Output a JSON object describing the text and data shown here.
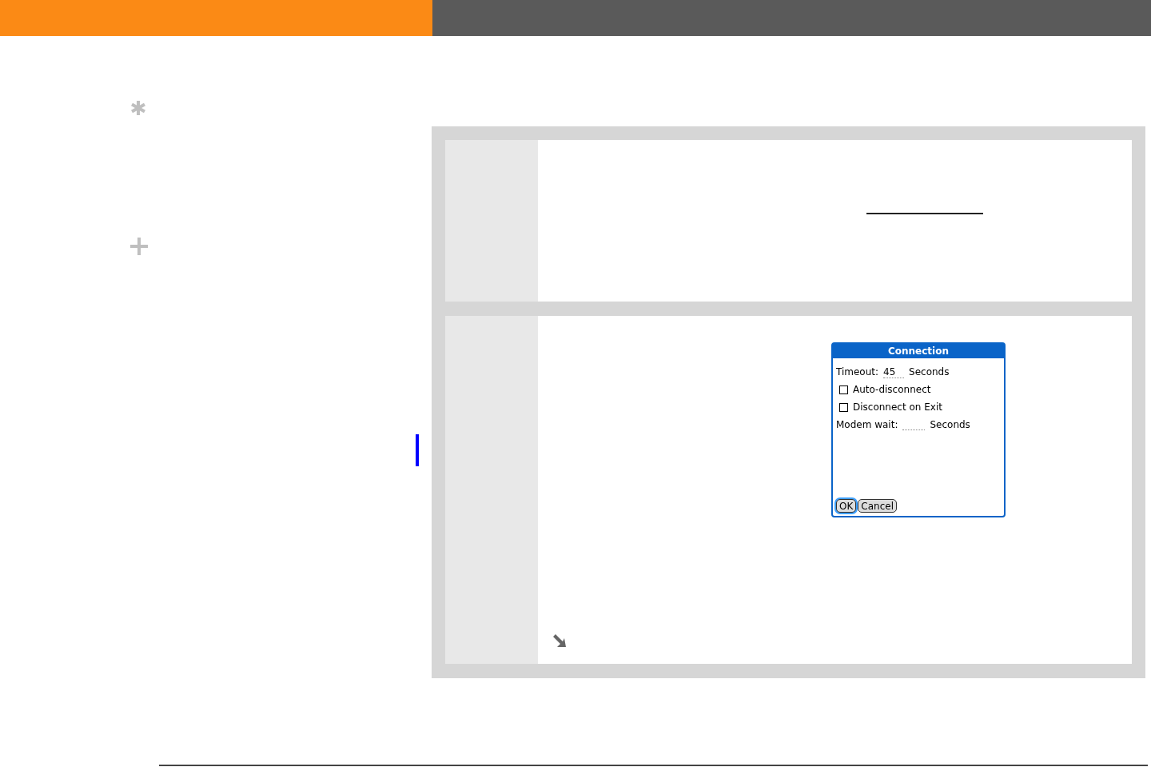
{
  "dialog": {
    "title": "Connection",
    "timeout": {
      "label": "Timeout:",
      "value": "45",
      "unit": "Seconds"
    },
    "checkboxes": [
      {
        "label": "Auto-disconnect",
        "checked": false
      },
      {
        "label": "Disconnect on Exit",
        "checked": false
      }
    ],
    "modem_wait": {
      "label": "Modem wait:",
      "unit": "Seconds"
    },
    "buttons": [
      {
        "label": "OK",
        "selected": true
      },
      {
        "label": "Cancel",
        "selected": false
      }
    ]
  }
}
